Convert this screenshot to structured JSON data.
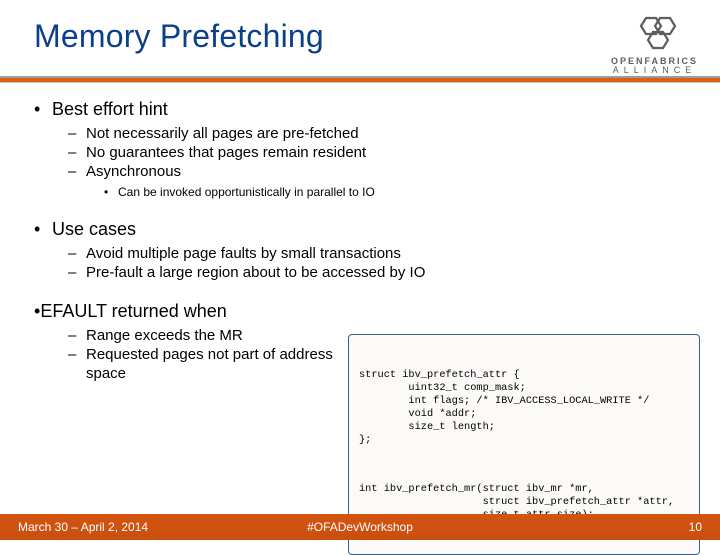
{
  "title": "Memory Prefetching",
  "logo": {
    "line1": "OPENFABRICS",
    "line2": "ALLIANCE"
  },
  "bullets": {
    "b1": {
      "label": "Best effort hint",
      "sub": [
        "Not necessarily all pages are pre-fetched",
        "No guarantees that pages remain resident",
        "Asynchronous"
      ],
      "subsub": [
        "Can be invoked opportunistically in parallel to IO"
      ]
    },
    "b2": {
      "label": "Use cases",
      "sub": [
        "Avoid multiple page faults by small transactions",
        "Pre-fault a large region about to be accessed by IO"
      ]
    },
    "b3": {
      "label": "EFAULT returned when",
      "sub": [
        "Range exceeds the MR",
        "Requested pages not part of address space"
      ]
    }
  },
  "code": {
    "block1": "struct ibv_prefetch_attr {\n        uint32_t comp_mask;\n        int flags; /* IBV_ACCESS_LOCAL_WRITE */\n        void *addr;\n        size_t length;\n};",
    "block2": "int ibv_prefetch_mr(struct ibv_mr *mr,\n                    struct ibv_prefetch_attr *attr,\n                    size_t attr_size);"
  },
  "footer": {
    "left": "March 30 – April 2, 2014",
    "center": "#OFADevWorkshop",
    "right": "10"
  }
}
